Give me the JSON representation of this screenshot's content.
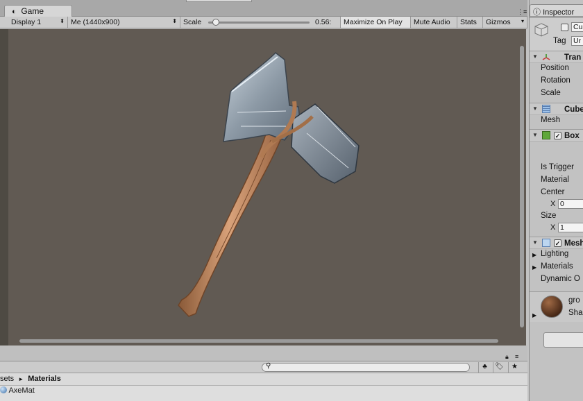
{
  "game_tab": {
    "label": "Game"
  },
  "toolbar": {
    "display": "Display 1",
    "resolution": "Me (1440x900)",
    "scale_label": "Scale",
    "scale_value": "0.56:",
    "scale_fraction": 0.03,
    "maximize_on_play": "Maximize On Play",
    "mute_audio": "Mute Audio",
    "stats": "Stats",
    "gizmos": "Gizmos"
  },
  "project": {
    "breadcrumb_prefix": "sets",
    "breadcrumb_separator": "►",
    "breadcrumb_current": "Materials",
    "assets": [
      "AxeMat"
    ]
  },
  "inspector": {
    "tab_label": "Inspector",
    "object_name": "Cu",
    "tag_label": "Tag",
    "tag_value": "Ur",
    "transform": {
      "title": "Tran",
      "rows": [
        "Position",
        "Rotation",
        "Scale"
      ]
    },
    "mesh_filter": {
      "title": "Cube",
      "rows": [
        "Mesh"
      ]
    },
    "box_collider": {
      "title": "Box",
      "rows": [
        "Is Trigger",
        "Material",
        "Center",
        "Size"
      ],
      "center_x_label": "X",
      "center_x": "0",
      "size_x_label": "X",
      "size_x": "1"
    },
    "mesh_renderer": {
      "title": "Mesh",
      "rows": [
        "Lighting",
        "Materials",
        "Dynamic O"
      ]
    },
    "material": {
      "name": "gro",
      "shader_label": "Sha"
    }
  }
}
